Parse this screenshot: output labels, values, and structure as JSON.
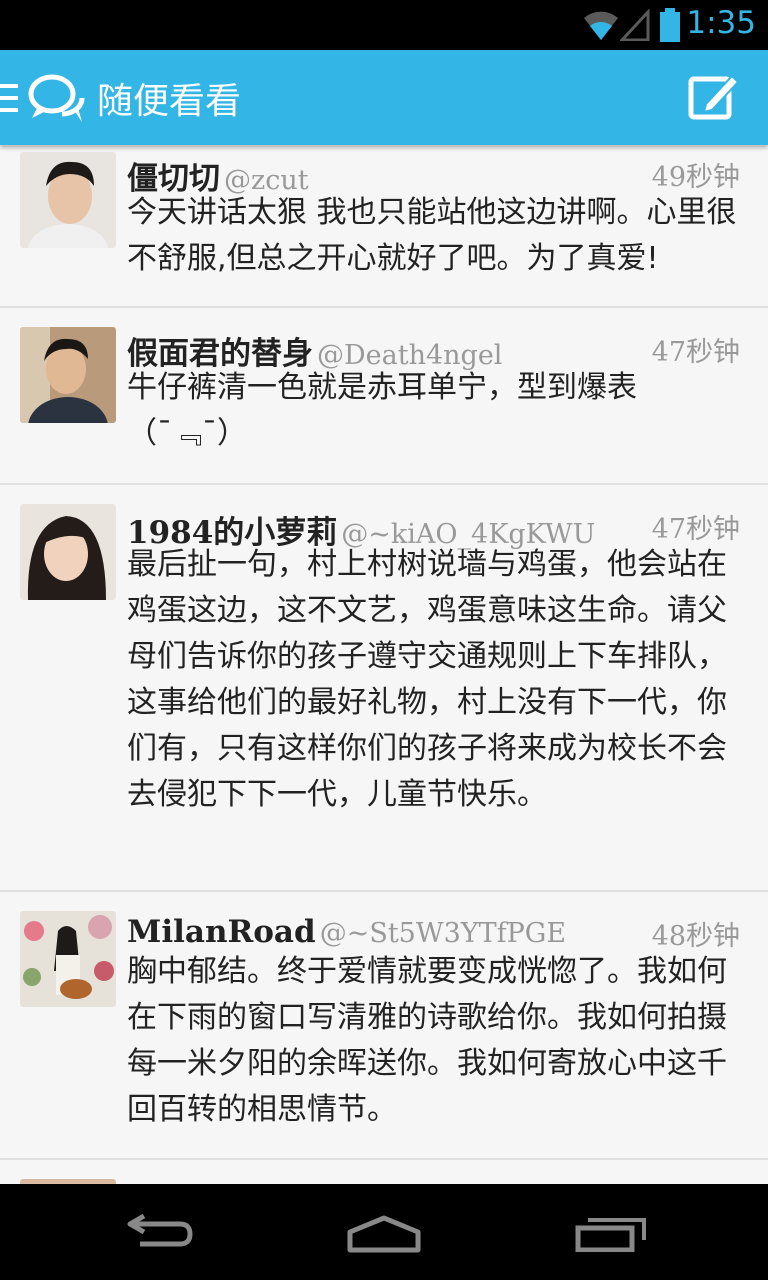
{
  "status_bar": {
    "time": "1:35"
  },
  "action_bar": {
    "title": "随便看看"
  },
  "feed": [
    {
      "username": "僵切切",
      "handle": "@zcut",
      "time": "49秒钟",
      "text": "今天讲话太狠 我也只能站他这边讲啊。心里很不舒服,但总之开心就好了吧。为了真爱!"
    },
    {
      "username": "假面君的替身",
      "handle": "@Death4ngel",
      "time": "47秒钟",
      "text": "牛仔裤清一色就是赤耳单宁，型到爆表（¯﹃¯）"
    },
    {
      "username": "1984的小萝莉",
      "handle": "@~kiAO_4KgKWU",
      "time": "47秒钟",
      "text": "最后扯一句，村上村树说墙与鸡蛋，他会站在鸡蛋这边，这不文艺，鸡蛋意味这生命。请父母们告诉你的孩子遵守交通规则上下车排队，这事给他们的最好礼物，村上没有下一代，你们有，只有这样你们的孩子将来成为校长不会去侵犯下下一代，儿童节快乐。"
    },
    {
      "username": "MilanRoad",
      "handle": "@~St5W3YTfPGE",
      "time": "48秒钟",
      "text": "胸中郁结。终于爱情就要变成恍惚了。我如何在下雨的窗口写清雅的诗歌给你。我如何拍摄每一米夕阳的余晖送你。我如何寄放心中这千回百转的相思情节。"
    }
  ],
  "icons": {
    "wifi": "wifi-icon",
    "signal": "signal-icon",
    "battery": "battery-icon",
    "menu": "menu-icon",
    "logo": "chat-bubbles-icon",
    "compose": "compose-icon",
    "back": "back-icon",
    "home": "home-icon",
    "recent": "recent-apps-icon"
  },
  "colors": {
    "accent": "#33b5e5",
    "background": "#f4f4f4",
    "text": "#222222",
    "muted": "#999999"
  }
}
